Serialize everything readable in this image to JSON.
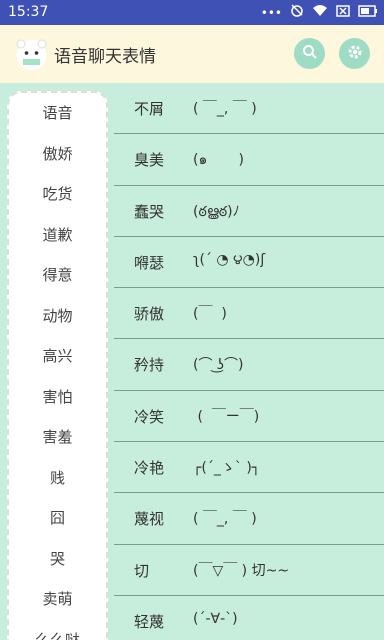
{
  "status": {
    "time": "15:37",
    "dots": "•••"
  },
  "app": {
    "title": "语音聊天表情"
  },
  "sidebar": {
    "items": [
      "语音",
      "傲娇",
      "吃货",
      "道歉",
      "得意",
      "动物",
      "高兴",
      "害怕",
      "害羞",
      "贱",
      "囧",
      "哭",
      "卖萌",
      "么么哒"
    ]
  },
  "list": [
    {
      "name": "不屑",
      "face": "( ￣_, ￣ )"
    },
    {
      "name": "臭美",
      "face": "(๑       )"
    },
    {
      "name": "蠢哭",
      "face": "(ఠൠఠ)ﾉ"
    },
    {
      "name": "嘚瑟",
      "face": "ʅ(´ ◔ ౪◔)ʃ"
    },
    {
      "name": "骄傲",
      "face": "(￣  )"
    },
    {
      "name": "矜持",
      "face": "(⌒ ͜ʖ⌒)"
    },
    {
      "name": "冷笑",
      "face": " (  ￣ー￣)"
    },
    {
      "name": "冷艳",
      "face": "┌(´_ゝ` )┐"
    },
    {
      "name": "蔑视",
      "face": "( ￣_, ￣ )"
    },
    {
      "name": "切",
      "face": "(￣▽￣ ) 切~~"
    },
    {
      "name": "轻蔑",
      "face": "(´-∀-`)"
    }
  ]
}
